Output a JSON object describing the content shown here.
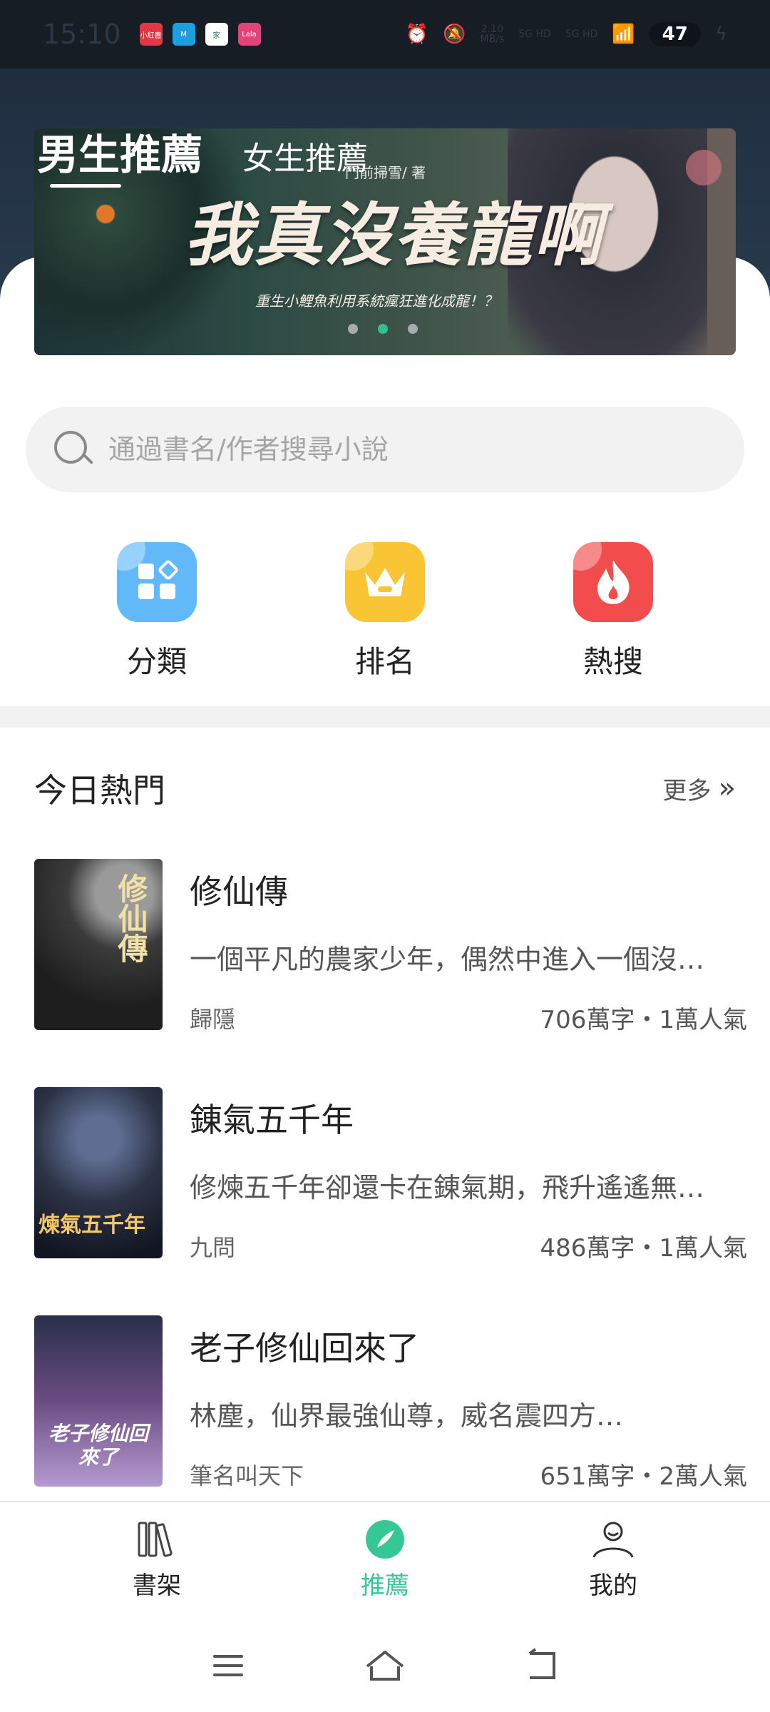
{
  "status_bar": {
    "time": "15:10",
    "apps": [
      "小紅書",
      "M",
      "家",
      "Lala"
    ],
    "net_speed": "2.10\nMB/s",
    "signal_1": "5G HD",
    "signal_2": "5G HD",
    "battery": "47"
  },
  "tabs": [
    {
      "label": "男生推薦",
      "active": true
    },
    {
      "label": "女生推薦",
      "active": false
    }
  ],
  "banner": {
    "title": "我真沒養龍啊",
    "author": "門前掃雪/ 著",
    "subtitle": "重生小鯉魚利用系統瘋狂進化成龍！？",
    "dot_count": 3,
    "active_dot": 1
  },
  "search": {
    "placeholder": "通過書名/作者搜尋小說"
  },
  "quick_actions": [
    {
      "label": "分類",
      "icon": "category-icon",
      "color": "#62b9fa"
    },
    {
      "label": "排名",
      "icon": "crown-icon",
      "color": "#f9c534"
    },
    {
      "label": "熱搜",
      "icon": "flame-icon",
      "color": "#f24c4c"
    }
  ],
  "section": {
    "title": "今日熱門",
    "more": "更多"
  },
  "books": [
    {
      "title": "修仙傳",
      "desc": "一個平凡的農家少年，偶然中進入一個沒…",
      "author": "歸隱",
      "stats": "706萬字・1萬人氣",
      "cover_text": "修仙傳"
    },
    {
      "title": "錬氣五千年",
      "desc": "修煉五千年卻還卡在錬氣期，飛升遙遙無…",
      "author": "九問",
      "stats": "486萬字・1萬人氣",
      "cover_text": "煉氣五千年"
    },
    {
      "title": "老子修仙回來了",
      "desc": "林塵，仙界最強仙尊，威名震四方…",
      "author": "筆名叫天下",
      "stats": "651萬字・2萬人氣",
      "cover_text": "老子修仙回來了"
    }
  ],
  "bottom_nav": [
    {
      "label": "書架",
      "icon": "bookshelf-icon",
      "active": false
    },
    {
      "label": "推薦",
      "icon": "recommend-icon",
      "active": true
    },
    {
      "label": "我的",
      "icon": "profile-icon",
      "active": false
    }
  ],
  "colors": {
    "accent": "#35c895",
    "header_bg": "#223244"
  }
}
